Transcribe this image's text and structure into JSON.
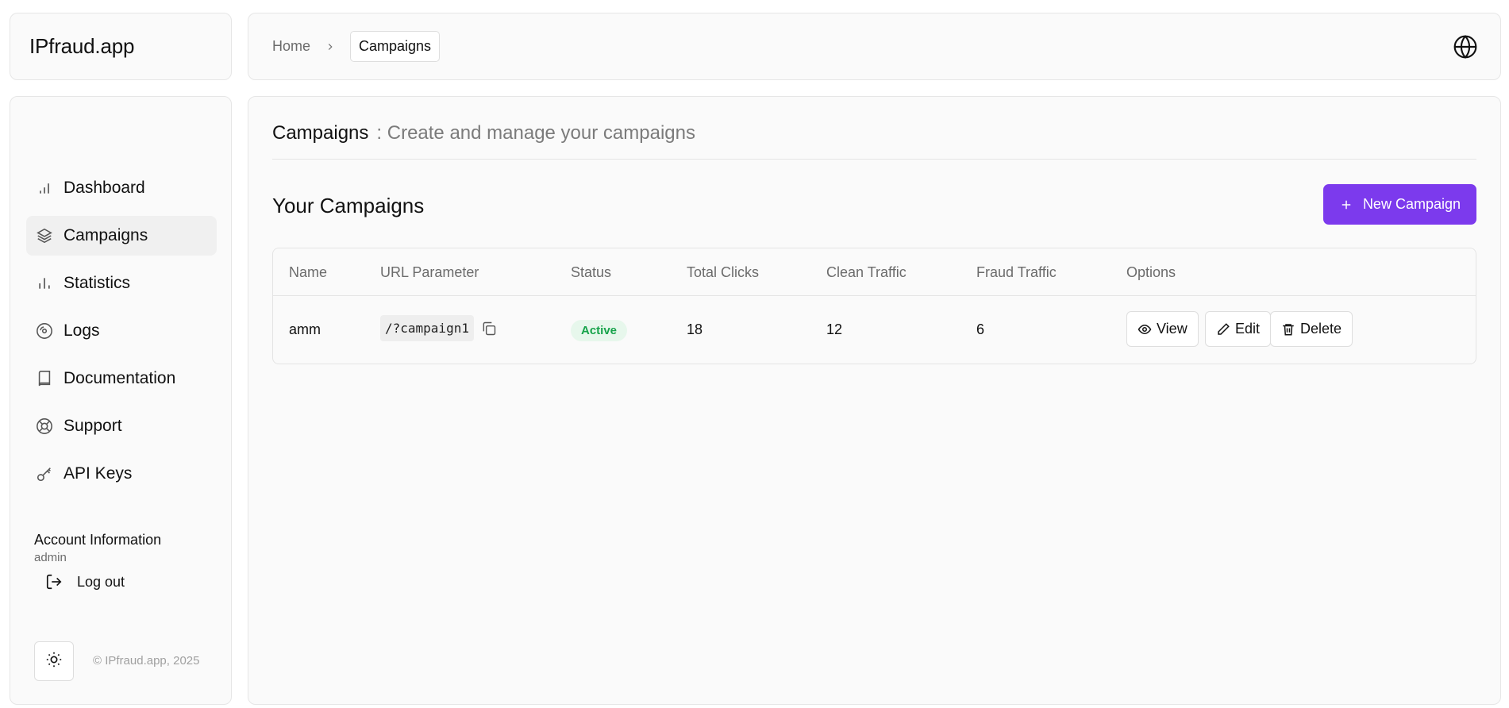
{
  "brand": {
    "name": "IPfraud.app"
  },
  "breadcrumb": {
    "home": "Home",
    "current": "Campaigns"
  },
  "sidebar": {
    "items": [
      {
        "label": "Dashboard",
        "icon": "bar-chart-icon"
      },
      {
        "label": "Campaigns",
        "icon": "layers-icon",
        "active": true
      },
      {
        "label": "Statistics",
        "icon": "statistics-icon"
      },
      {
        "label": "Logs",
        "icon": "disc-icon"
      },
      {
        "label": "Documentation",
        "icon": "book-icon"
      },
      {
        "label": "Support",
        "icon": "life-buoy-icon"
      },
      {
        "label": "API Keys",
        "icon": "key-icon"
      }
    ],
    "account_title": "Account Information",
    "account_user": "admin",
    "logout_label": "Log out",
    "copyright": "© IPfraud.app, 2025"
  },
  "main": {
    "page_title": "Campaigns",
    "page_subtitle": ": Create and manage your campaigns",
    "section_title": "Your Campaigns",
    "new_button_label": "New Campaign"
  },
  "table": {
    "columns": [
      "Name",
      "URL Parameter",
      "Status",
      "Total Clicks",
      "Clean Traffic",
      "Fraud Traffic",
      "Options"
    ],
    "rows": [
      {
        "name": "amm",
        "url_parameter": "/?campaign1",
        "status": "Active",
        "total_clicks": "18",
        "clean_traffic": "12",
        "fraud_traffic": "6",
        "options": {
          "view": "View",
          "edit": "Edit",
          "delete": "Delete"
        }
      }
    ]
  },
  "colors": {
    "accent": "#7c3aed",
    "status_active_bg": "#e7f7ec",
    "status_active_text": "#16a34a"
  }
}
